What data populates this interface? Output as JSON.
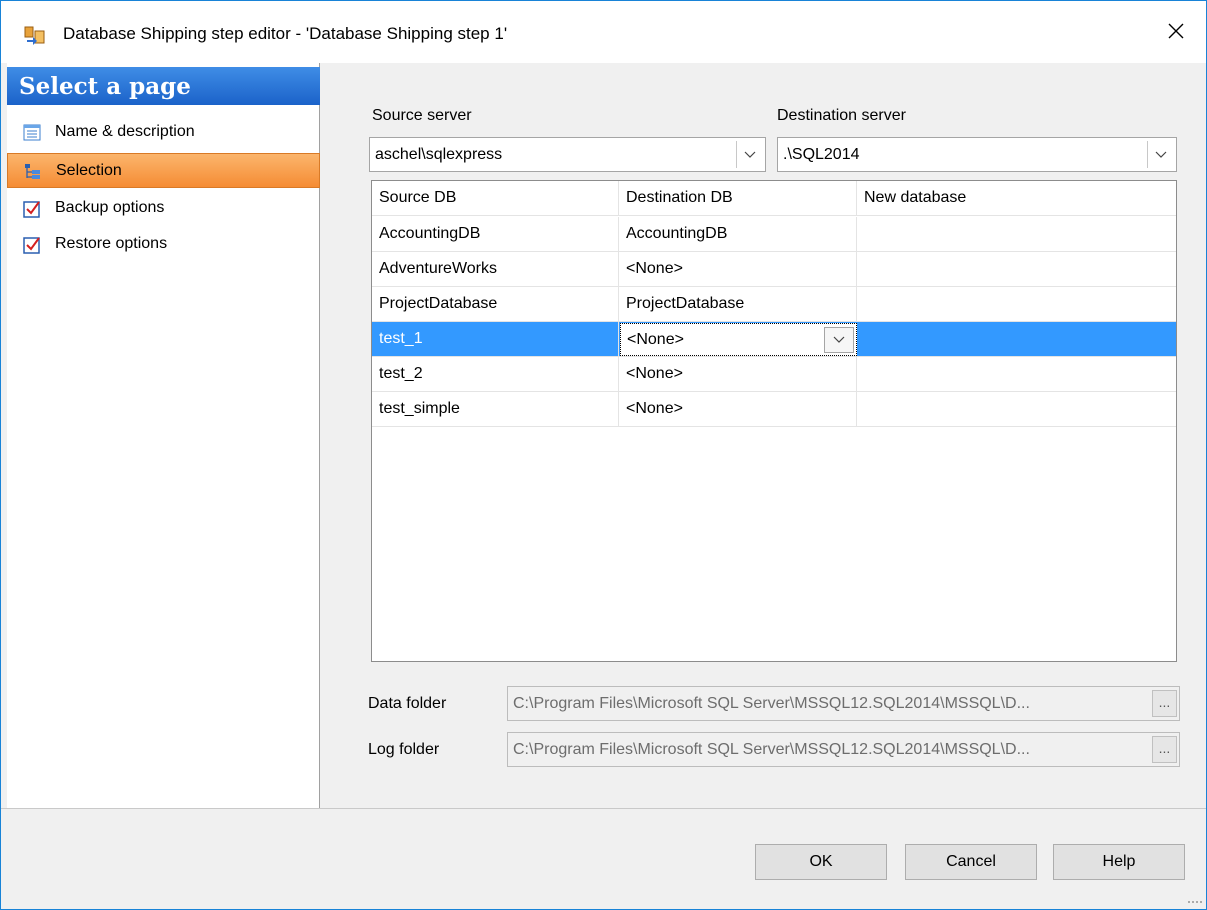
{
  "window": {
    "title": "Database Shipping step editor - 'Database Shipping step 1'",
    "close_icon": "close-icon",
    "accent_color": "#1883d7"
  },
  "sidebar": {
    "header": "Select a page",
    "items": [
      {
        "label": "Name & description",
        "icon": "list-icon",
        "active": false
      },
      {
        "label": "Selection",
        "icon": "tree-icon",
        "active": true
      },
      {
        "label": "Backup options",
        "icon": "checklist-icon",
        "active": false
      },
      {
        "label": "Restore options",
        "icon": "checklist-icon",
        "active": false
      }
    ],
    "active_color": "#f58c34",
    "header_color": "#1b62c9"
  },
  "source_server": {
    "label": "Source server",
    "value": "aschel\\sqlexpress"
  },
  "destination_server": {
    "label": "Destination server",
    "value": ".\\SQL2014"
  },
  "grid": {
    "columns": [
      "Source DB",
      "Destination DB",
      "New database"
    ],
    "rows": [
      {
        "source": "AccountingDB",
        "destination": "AccountingDB",
        "new_db": ""
      },
      {
        "source": "AdventureWorks",
        "destination": "<None>",
        "new_db": ""
      },
      {
        "source": "ProjectDatabase",
        "destination": "ProjectDatabase",
        "new_db": ""
      },
      {
        "source": "test_1",
        "destination": "<None>",
        "new_db": "",
        "selected": true
      },
      {
        "source": "test_2",
        "destination": "<None>",
        "new_db": ""
      },
      {
        "source": "test_simple",
        "destination": "<None>",
        "new_db": ""
      }
    ],
    "selection_color": "#3399ff"
  },
  "folders": {
    "data_label": "Data folder",
    "data_value": "C:\\Program Files\\Microsoft SQL Server\\MSSQL12.SQL2014\\MSSQL\\D...",
    "log_label": "Log folder",
    "log_value": "C:\\Program Files\\Microsoft SQL Server\\MSSQL12.SQL2014\\MSSQL\\D...",
    "browse_label": "..."
  },
  "buttons": {
    "ok": "OK",
    "cancel": "Cancel",
    "help": "Help"
  }
}
